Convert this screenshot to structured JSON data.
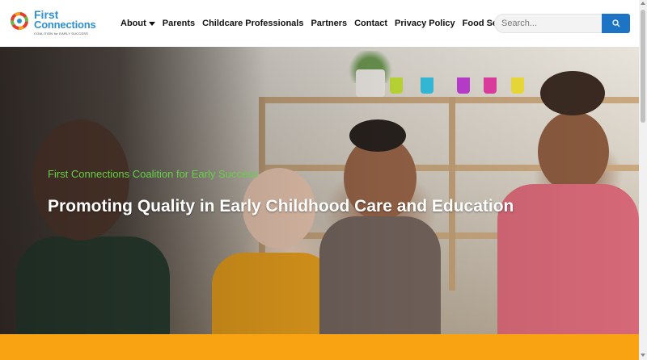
{
  "logo": {
    "line1": "First",
    "line2": "Connections",
    "tagline": "COALITION for EARLY SUCCESS"
  },
  "nav": {
    "items": [
      {
        "label": "About",
        "has_dropdown": true
      },
      {
        "label": "Parents"
      },
      {
        "label": "Childcare Professionals"
      },
      {
        "label": "Partners"
      },
      {
        "label": "Contact"
      },
      {
        "label": "Privacy Policy"
      },
      {
        "label": "Food Security"
      }
    ]
  },
  "search": {
    "placeholder": "Search...",
    "value": "",
    "button_icon": "search-icon"
  },
  "hero": {
    "subtitle": "First Connections Coalition for Early Success",
    "title": "Promoting Quality in Early Childhood Care and Education",
    "subtitle_color": "#65d148"
  },
  "colors": {
    "brand_blue": "#2f8fd1",
    "search_button": "#1e74c4",
    "band_orange": "#f9a312"
  }
}
